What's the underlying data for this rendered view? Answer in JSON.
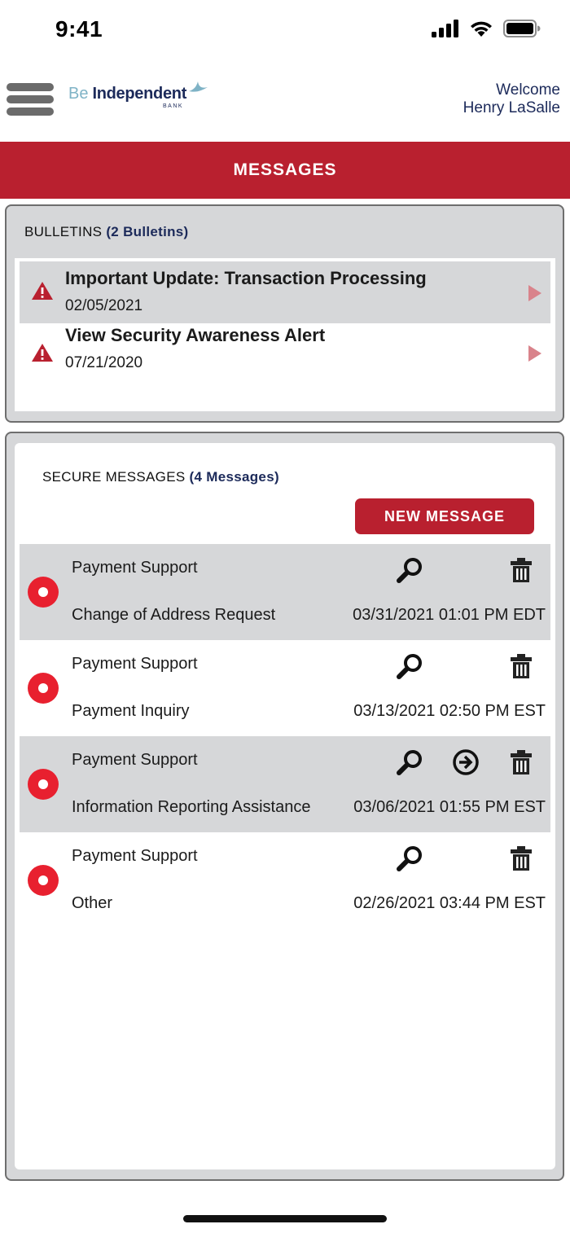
{
  "status_bar": {
    "time": "9:41"
  },
  "header": {
    "logo": {
      "be": "Be",
      "independent": "Independent",
      "bank": "BANK"
    },
    "welcome_line1": "Welcome",
    "welcome_line2": "Henry LaSalle"
  },
  "page_title": "MESSAGES",
  "bulletins": {
    "label": "BULLETINS",
    "count": "(2 Bulletins)",
    "items": [
      {
        "title": "Important Update: Transaction Processing",
        "date": "02/05/2021"
      },
      {
        "title": "View Security Awareness Alert",
        "date": "07/21/2020"
      }
    ]
  },
  "secure_messages": {
    "label": "SECURE MESSAGES",
    "count": "(4 Messages)",
    "new_message_label": "NEW MESSAGE",
    "items": [
      {
        "from": "Payment Support",
        "subject": "Change of Address Request",
        "date": "03/31/2021 01:01 PM EDT",
        "has_forward": false
      },
      {
        "from": "Payment Support",
        "subject": "Payment Inquiry",
        "date": "03/13/2021 02:50 PM EST",
        "has_forward": false
      },
      {
        "from": "Payment Support",
        "subject": "Information Reporting Assistance",
        "date": "03/06/2021 01:55 PM EST",
        "has_forward": true
      },
      {
        "from": "Payment Support",
        "subject": "Other",
        "date": "02/26/2021 03:44 PM EST",
        "has_forward": false
      }
    ]
  },
  "colors": {
    "brand_red": "#b9202f",
    "unread_red": "#e8202f",
    "navy": "#1c2a5a",
    "panel_gray": "#d6d7d9"
  },
  "icons": [
    "signal-icon",
    "wifi-icon",
    "battery-icon",
    "menu-icon",
    "warning-icon",
    "chevron-right-icon",
    "search-icon",
    "forward-icon",
    "trash-icon"
  ]
}
